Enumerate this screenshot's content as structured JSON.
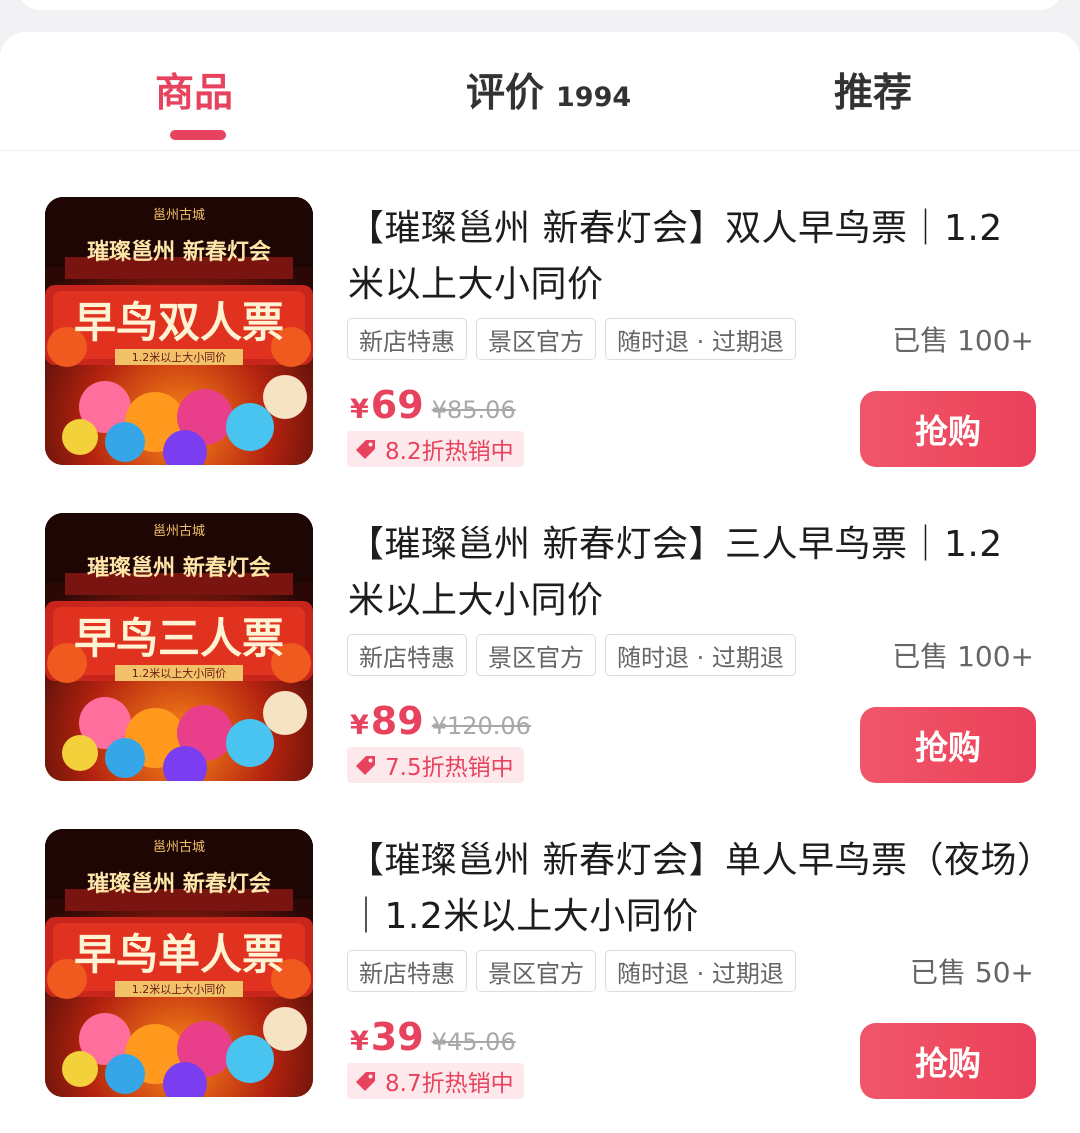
{
  "tabs": [
    {
      "label": "商品",
      "count": ""
    },
    {
      "label": "评价",
      "count": "1994"
    },
    {
      "label": "推荐",
      "count": ""
    }
  ],
  "colors": {
    "accent": "#e8435e",
    "discount_bg": "#fde9ec",
    "tag_border": "#dcdcdc"
  },
  "products": [
    {
      "title": "【璀璨邕州 新春灯会】双人早鸟票｜1.2米以上大小同价",
      "image": {
        "logo": "邕州古城",
        "headline": "璀璨邕州    新春灯会",
        "banner": "早鸟双人票",
        "subline": "1.2米以上大小同价"
      },
      "tags": [
        "新店特惠",
        "景区官方",
        "随时退 · 过期退"
      ],
      "sold": "已售 100+",
      "currency": "¥",
      "price": "69",
      "original_price": "¥85.06",
      "discount": "8.2折热销中",
      "buy_label": "抢购"
    },
    {
      "title": "【璀璨邕州 新春灯会】三人早鸟票｜1.2米以上大小同价",
      "image": {
        "logo": "邕州古城",
        "headline": "璀璨邕州    新春灯会",
        "banner": "早鸟三人票",
        "subline": "1.2米以上大小同价"
      },
      "tags": [
        "新店特惠",
        "景区官方",
        "随时退 · 过期退"
      ],
      "sold": "已售 100+",
      "currency": "¥",
      "price": "89",
      "original_price": "¥120.06",
      "discount": "7.5折热销中",
      "buy_label": "抢购"
    },
    {
      "title": "【璀璨邕州 新春灯会】单人早鸟票（夜场）｜1.2米以上大小同价",
      "image": {
        "logo": "邕州古城",
        "headline": "璀璨邕州    新春灯会",
        "banner": "早鸟单人票",
        "subline": "1.2米以上大小同价"
      },
      "tags": [
        "新店特惠",
        "景区官方",
        "随时退 · 过期退"
      ],
      "sold": "已售 50+",
      "currency": "¥",
      "price": "39",
      "original_price": "¥45.06",
      "discount": "8.7折热销中",
      "buy_label": "抢购"
    }
  ]
}
